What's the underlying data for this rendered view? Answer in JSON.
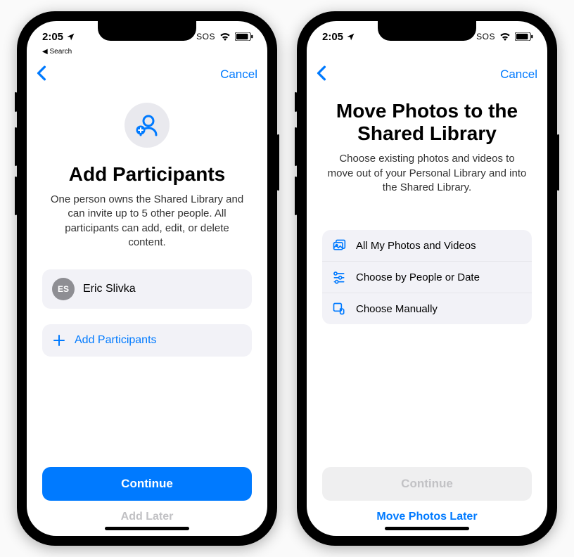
{
  "status": {
    "time": "2:05",
    "back_label": "Search",
    "sos": "SOS"
  },
  "nav": {
    "cancel": "Cancel"
  },
  "screen1": {
    "title": "Add Participants",
    "subtitle": "One person owns the Shared Library and can invite up to 5 other people. All participants can add, edit, or delete content.",
    "owner": {
      "initials": "ES",
      "name": "Eric Slivka"
    },
    "add_label": "Add Participants",
    "continue": "Continue",
    "later": "Add Later"
  },
  "screen2": {
    "title": "Move Photos to the Shared Library",
    "subtitle": "Choose existing photos and videos to move out of your Personal Library and into the Shared Library.",
    "options": {
      "all": "All My Photos and Videos",
      "people": "Choose by People or Date",
      "manual": "Choose Manually"
    },
    "continue": "Continue",
    "later": "Move Photos Later"
  }
}
